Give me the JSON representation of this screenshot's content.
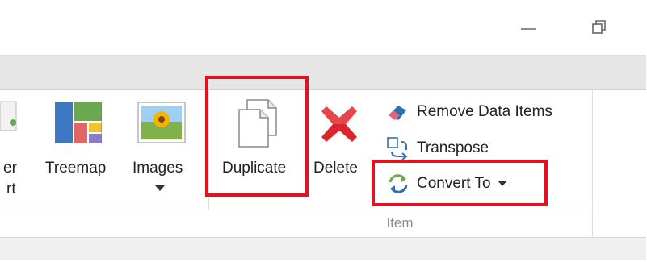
{
  "ribbon": {
    "partial_button": {
      "label_line1": "er",
      "label_line2": "rt"
    },
    "treemap": {
      "label": "Treemap"
    },
    "images": {
      "label": "Images"
    },
    "duplicate": {
      "label": "Duplicate"
    },
    "delete": {
      "label": "Delete"
    },
    "item_group": {
      "caption": "Item",
      "remove_data_items": "Remove Data Items",
      "transpose": "Transpose",
      "convert_to": "Convert To"
    }
  },
  "icons": {
    "minimize": "minimize-icon",
    "restore": "restore-icon",
    "treemap": "treemap-icon",
    "images": "image-icon",
    "duplicate": "duplicate-icon",
    "delete": "delete-x-icon",
    "remove_data_items": "eraser-icon",
    "transpose": "transpose-icon",
    "convert_to": "convert-arrows-icon"
  },
  "colors": {
    "highlight": "#e3121f",
    "delete_red": "#d9262c",
    "accent_blue": "#2f6fb5",
    "accent_green": "#6aa84f"
  }
}
